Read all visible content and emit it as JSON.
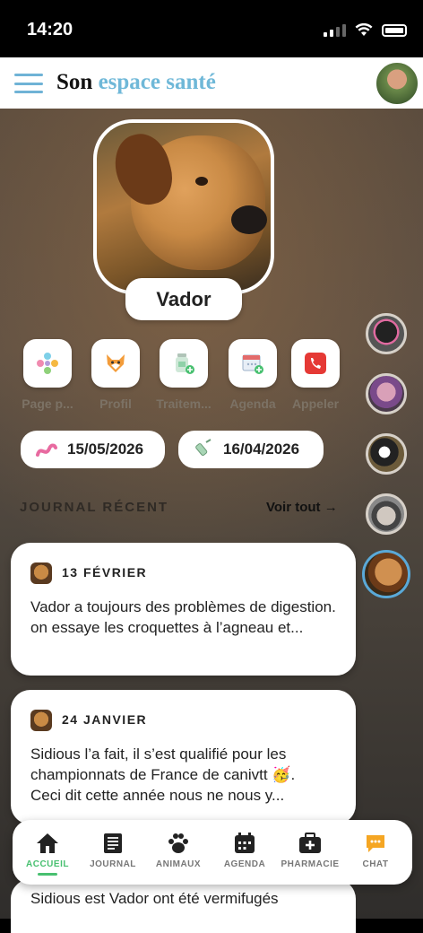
{
  "status": {
    "time": "14:20"
  },
  "header": {
    "title_prefix": "Son",
    "title_accent": "espace santé"
  },
  "pet": {
    "name": "Vador"
  },
  "actions": [
    {
      "label": "Page p...",
      "icon": "page-icon"
    },
    {
      "label": "Profil",
      "icon": "fox-profile-icon"
    },
    {
      "label": "Traitem...",
      "icon": "medicine-icon"
    },
    {
      "label": "Agenda",
      "icon": "calendar-add-icon"
    },
    {
      "label": "Appeler",
      "icon": "phone-call-icon"
    }
  ],
  "reminders": [
    {
      "date": "15/05/2026",
      "icon": "worm-icon"
    },
    {
      "date": "16/04/2026",
      "icon": "syringe-icon"
    }
  ],
  "journal": {
    "section_title": "JOURNAL RÉCENT",
    "see_all": "Voir tout →",
    "entries": [
      {
        "date": "13 FÉVRIER",
        "line1": "Vador a toujours des problèmes de digestion.",
        "line2": "on essaye les croquettes à l’agneau et..."
      },
      {
        "date": "24 JANVIER",
        "line1": "Sidious l’a fait, il s’est qualifié pour les championnats de France de canivtt 🥳.",
        "line2": "Ceci dit cette année nous ne nous y..."
      },
      {
        "text": "Sidious est Vador ont été vermifugés"
      }
    ]
  },
  "tabs": [
    {
      "label": "ACCUEIL",
      "icon": "home-icon",
      "active": true
    },
    {
      "label": "JOURNAL",
      "icon": "journal-icon"
    },
    {
      "label": "ANIMAUX",
      "icon": "paw-icon"
    },
    {
      "label": "AGENDA",
      "icon": "calendar-icon"
    },
    {
      "label": "PHARMACIE",
      "icon": "first-aid-icon"
    },
    {
      "label": "CHAT",
      "icon": "chat-icon"
    }
  ],
  "colors": {
    "accent": "#6fb8d8",
    "active_tab": "#48c070",
    "chat": "#f5a623",
    "call": "#e53935"
  }
}
